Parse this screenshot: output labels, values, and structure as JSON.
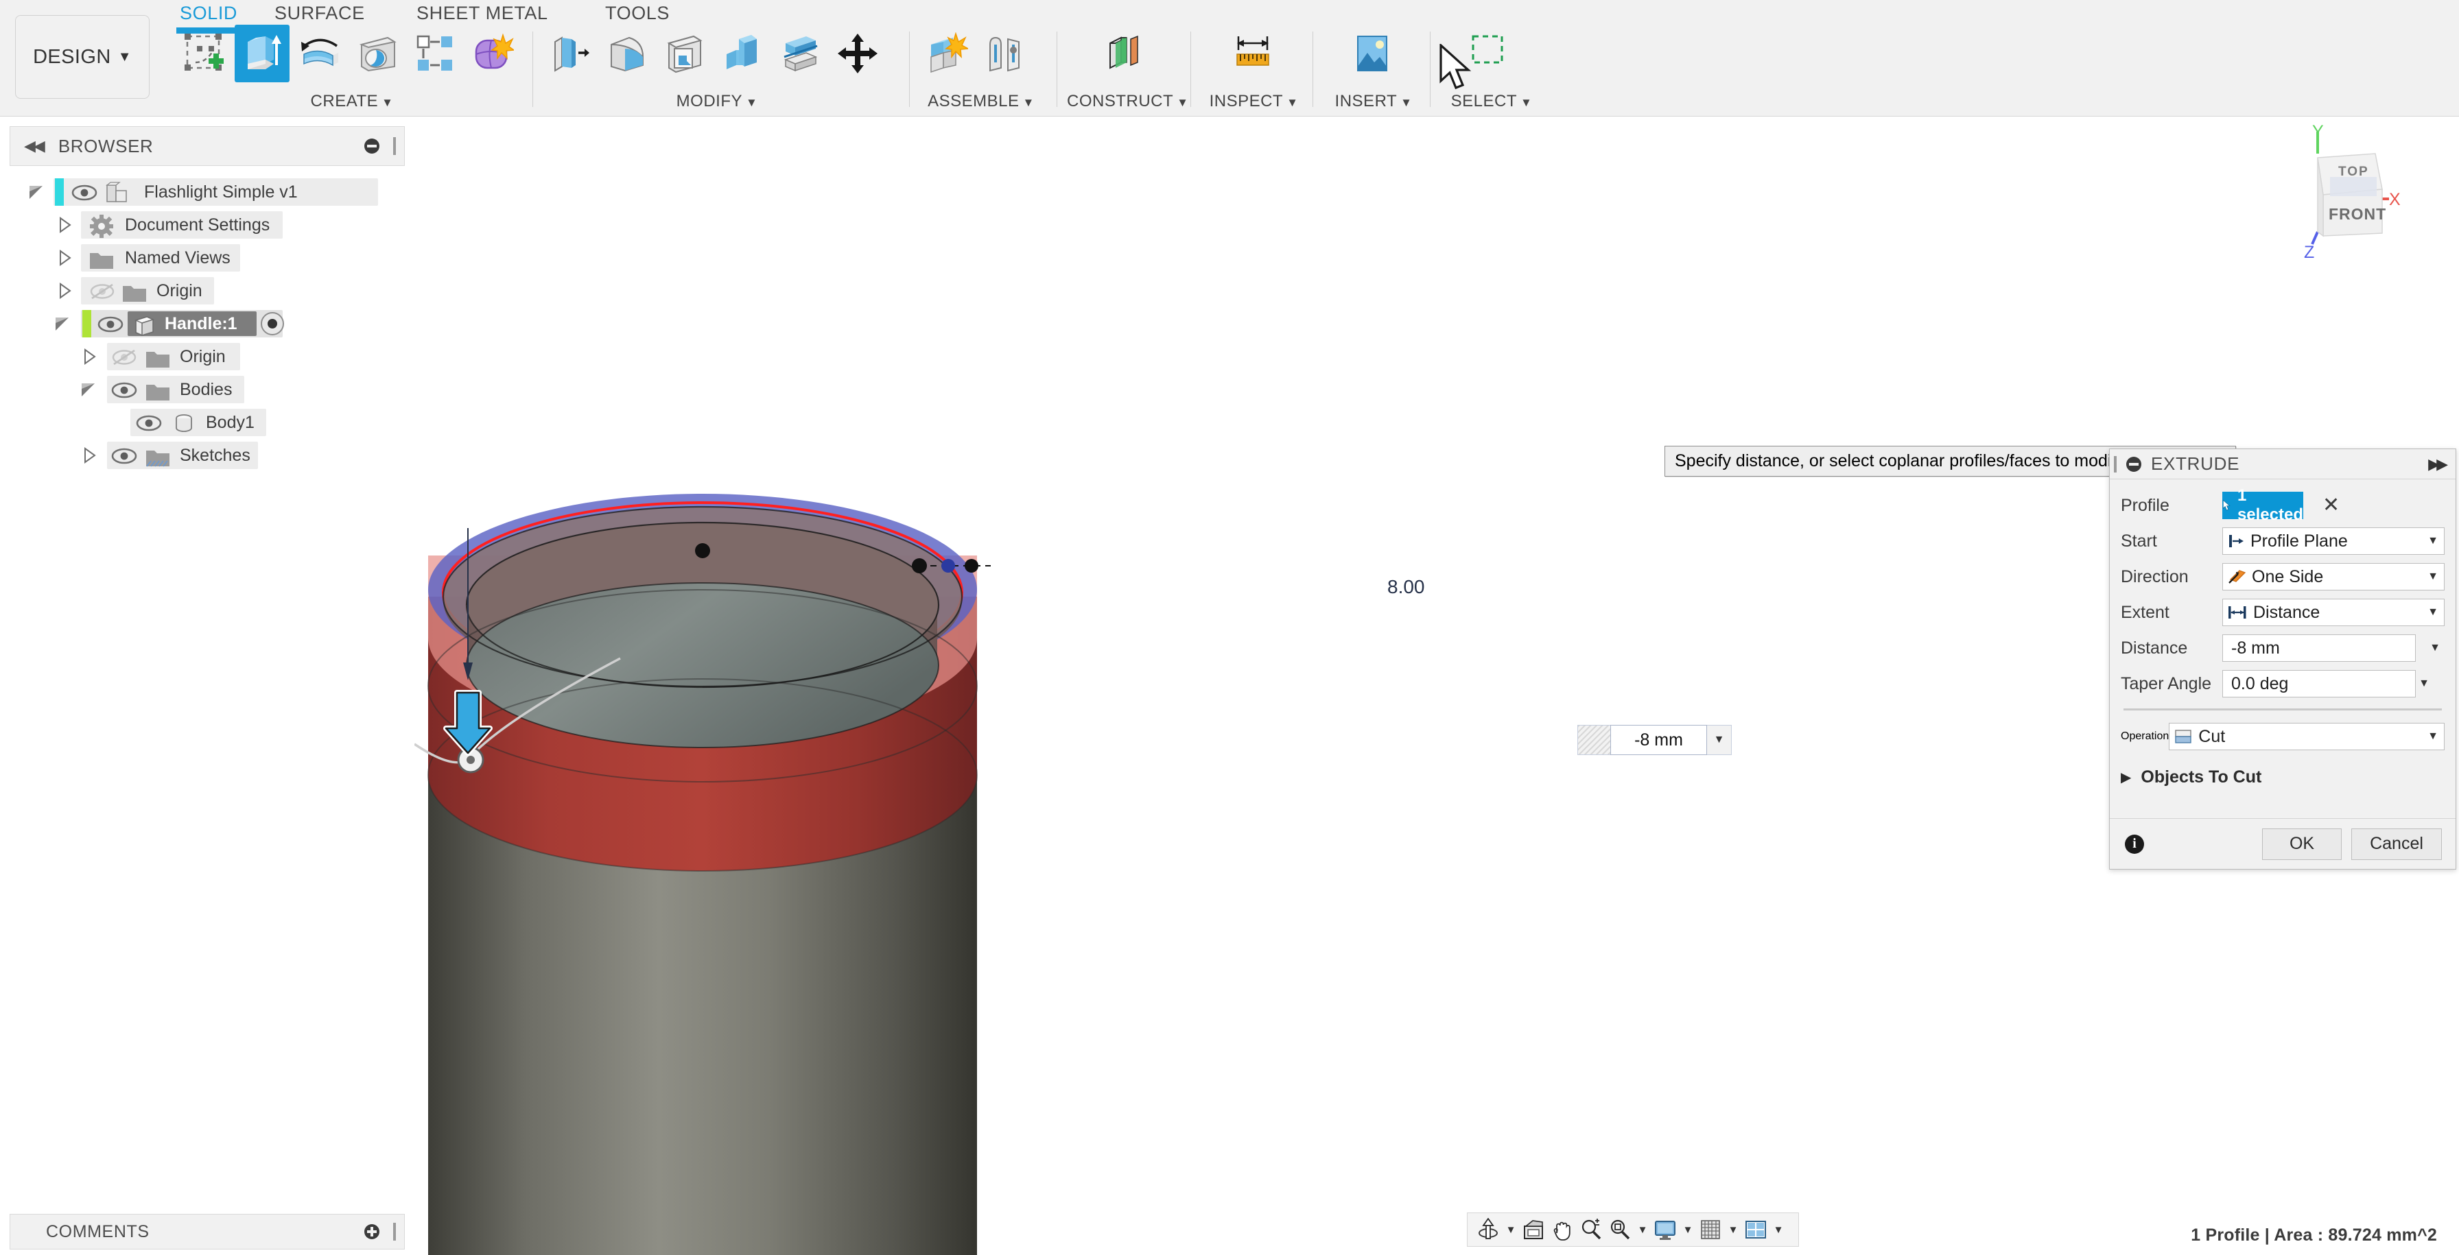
{
  "app": {
    "workspace_button": "DESIGN",
    "tabs": [
      {
        "label": "SOLID",
        "active": true
      },
      {
        "label": "SURFACE",
        "active": false
      },
      {
        "label": "SHEET METAL",
        "active": false
      },
      {
        "label": "TOOLS",
        "active": false
      }
    ],
    "groups": [
      {
        "label": "CREATE",
        "tools": [
          "create-sketch-icon",
          "extrude-icon",
          "revolve-icon",
          "sweep-icon",
          "pattern-icon",
          "form-icon"
        ],
        "active_tool": "extrude-icon"
      },
      {
        "label": "MODIFY",
        "tools": [
          "press-pull-icon",
          "fillet-icon",
          "shell-icon",
          "combine-icon",
          "split-face-icon",
          "move-copy-icon"
        ],
        "active_tool": null
      },
      {
        "label": "ASSEMBLE",
        "tools": [
          "new-component-icon",
          "joint-icon"
        ],
        "active_tool": null
      },
      {
        "label": "CONSTRUCT",
        "tools": [
          "construct-plane-icon"
        ],
        "active_tool": null
      },
      {
        "label": "INSPECT",
        "tools": [
          "measure-icon"
        ],
        "active_tool": null
      },
      {
        "label": "INSERT",
        "tools": [
          "insert-image-icon"
        ],
        "active_tool": null
      },
      {
        "label": "SELECT",
        "tools": [
          "select-window-icon"
        ],
        "active_tool": null
      }
    ]
  },
  "browser": {
    "title": "BROWSER",
    "collapse_icon": "collapse-left-icon",
    "options_icon": "panel-options-icon",
    "tree": [
      {
        "label": "Flashlight Simple v1",
        "depth": 0,
        "expander": "expanded",
        "eye": true,
        "icon": "document-icon",
        "color_bar": "#2fd9e0",
        "selected": false
      },
      {
        "label": "Document Settings",
        "depth": 1,
        "expander": "collapsed",
        "eye": false,
        "icon": "gear-icon",
        "color_bar": null,
        "selected": false
      },
      {
        "label": "Named Views",
        "depth": 1,
        "expander": "collapsed",
        "eye": false,
        "icon": "folder-icon",
        "color_bar": null,
        "selected": false
      },
      {
        "label": "Origin",
        "depth": 1,
        "expander": "collapsed",
        "eye": "hidden",
        "icon": "folder-icon",
        "color_bar": null,
        "selected": false
      },
      {
        "label": "Handle:1",
        "depth": 1,
        "expander": "expanded",
        "eye": true,
        "icon": "component-icon",
        "color_bar": "#aee337",
        "selected": true,
        "activated": true
      },
      {
        "label": "Origin",
        "depth": 2,
        "expander": "collapsed",
        "eye": "hidden",
        "icon": "folder-icon",
        "color_bar": null,
        "selected": false
      },
      {
        "label": "Bodies",
        "depth": 2,
        "expander": "expanded",
        "eye": true,
        "icon": "folder-icon",
        "color_bar": null,
        "selected": false
      },
      {
        "label": "Body1",
        "depth": 3,
        "expander": "none",
        "eye": true,
        "icon": "body-icon",
        "color_bar": null,
        "selected": false
      },
      {
        "label": "Sketches",
        "depth": 2,
        "expander": "collapsed",
        "eye": true,
        "icon": "sketches-folder-icon",
        "color_bar": null,
        "selected": false
      }
    ]
  },
  "comments": {
    "title": "COMMENTS",
    "add_icon": "add-comment-icon"
  },
  "viewport": {
    "tooltip": "Specify distance, or select coplanar profiles/faces to modify the selection",
    "dimension_label": "8.00",
    "distance_value": "-8 mm",
    "drag_arrow_icon": "drag-down-arrow-icon",
    "viewcube": {
      "top_face": "TOP",
      "front_face": "FRONT",
      "axis_x": "X",
      "axis_y": "Y",
      "axis_z": "Z",
      "color_x": "#e8554d",
      "color_y": "#5fd45f",
      "color_z": "#5560e8"
    },
    "navbar": [
      {
        "icon": "orbit-icon",
        "caret": true
      },
      {
        "icon": "look-at-icon",
        "caret": false
      },
      {
        "icon": "pan-hand-icon",
        "caret": false
      },
      {
        "icon": "zoom-icon",
        "caret": false
      },
      {
        "icon": "fit-icon",
        "caret": true
      },
      {
        "icon": "display-settings-icon",
        "caret": true
      },
      {
        "icon": "grid-snaps-icon",
        "caret": true
      },
      {
        "icon": "viewports-icon",
        "caret": true
      }
    ],
    "status": "1 Profile | Area : 89.724 mm^2",
    "model": {
      "selected_face_color": "#5b63c4",
      "cut_preview_color": "#a13530",
      "body_color": "#6e6e66",
      "profile_outline_color": "#ff2020"
    }
  },
  "extrude_dialog": {
    "title": "EXTRUDE",
    "minimize_icon": "dialog-collapse-icon",
    "expand_icon": "dialog-expand-icon",
    "fields": [
      {
        "name": "profile",
        "label": "Profile",
        "value": "1 selected",
        "type": "selection",
        "icon": "cursor-select-icon",
        "clear_icon": "clear-selection-icon"
      },
      {
        "name": "start",
        "label": "Start",
        "value": "Profile Plane",
        "type": "dropdown",
        "icon": "profile-plane-icon"
      },
      {
        "name": "direction",
        "label": "Direction",
        "value": "One Side",
        "type": "dropdown",
        "icon": "one-side-icon"
      },
      {
        "name": "extent",
        "label": "Extent",
        "value": "Distance",
        "type": "dropdown",
        "icon": "distance-extent-icon"
      },
      {
        "name": "distance",
        "label": "Distance",
        "value": "-8 mm",
        "type": "value"
      },
      {
        "name": "taper_angle",
        "label": "Taper Angle",
        "value": "0.0 deg",
        "type": "value"
      }
    ],
    "operation": {
      "label": "Operation",
      "value": "Cut",
      "icon": "cut-operation-icon"
    },
    "objects_to_cut": {
      "label": "Objects To Cut",
      "expander": "collapsed"
    },
    "info_icon": "info-icon",
    "ok_label": "OK",
    "cancel_label": "Cancel",
    "accent_color": "#0b96d5"
  }
}
